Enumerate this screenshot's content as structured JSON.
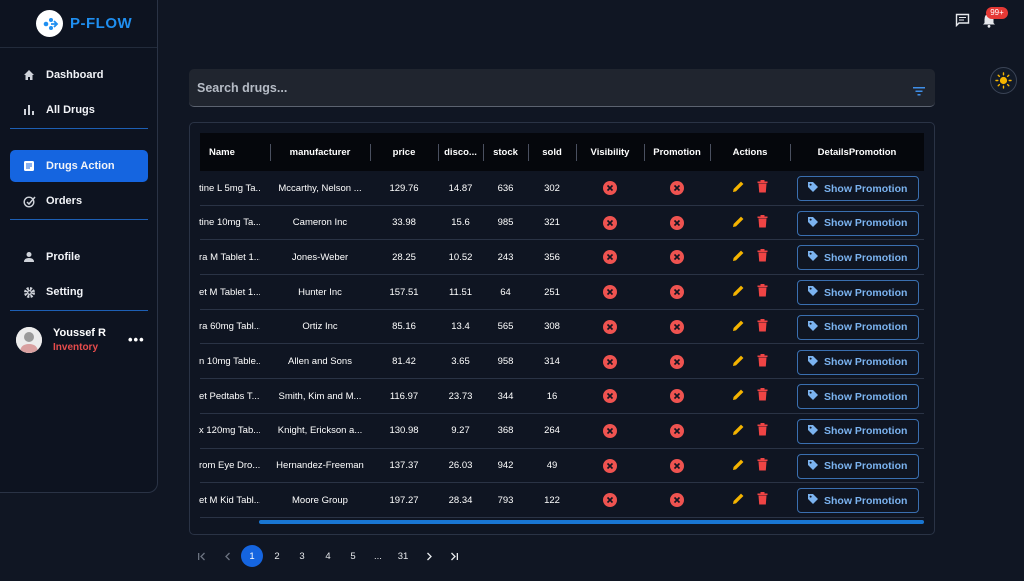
{
  "brand": {
    "name": "P-FLOW"
  },
  "nav": {
    "items": [
      {
        "label": "Dashboard",
        "icon": "home-icon"
      },
      {
        "label": "All Drugs",
        "icon": "bar-chart-icon"
      },
      {
        "label": "Drugs Action",
        "icon": "document-icon",
        "active": true
      },
      {
        "label": "Orders",
        "icon": "check-circle-icon"
      },
      {
        "label": "Profile",
        "icon": "person-icon"
      },
      {
        "label": "Setting",
        "icon": "gear-icon"
      }
    ]
  },
  "user": {
    "name": "Youssef R",
    "role": "Inventory",
    "more": "•••"
  },
  "header": {
    "notification_count": "99+"
  },
  "search": {
    "placeholder": "Search drugs...",
    "value": ""
  },
  "table": {
    "columns": [
      "Name",
      "manufacturer",
      "price",
      "disco...",
      "stock",
      "sold",
      "Visibility",
      "Promotion",
      "Actions",
      "DetailsPromotion"
    ],
    "promo_button_label": "Show Promotion",
    "rows": [
      {
        "name": "tine L 5mg Ta...",
        "manufacturer": "Mccarthy, Nelson ...",
        "price": "129.76",
        "discount": "14.87",
        "stock": "636",
        "sold": "302"
      },
      {
        "name": "tine 10mg Ta...",
        "manufacturer": "Cameron Inc",
        "price": "33.98",
        "discount": "15.6",
        "stock": "985",
        "sold": "321"
      },
      {
        "name": "ra M Tablet 1...",
        "manufacturer": "Jones-Weber",
        "price": "28.25",
        "discount": "10.52",
        "stock": "243",
        "sold": "356"
      },
      {
        "name": "et M Tablet 1...",
        "manufacturer": "Hunter Inc",
        "price": "157.51",
        "discount": "11.51",
        "stock": "64",
        "sold": "251"
      },
      {
        "name": "ra 60mg Tabl...",
        "manufacturer": "Ortiz Inc",
        "price": "85.16",
        "discount": "13.4",
        "stock": "565",
        "sold": "308"
      },
      {
        "name": "n 10mg Table...",
        "manufacturer": "Allen and Sons",
        "price": "81.42",
        "discount": "3.65",
        "stock": "958",
        "sold": "314"
      },
      {
        "name": "et Pedtabs T...",
        "manufacturer": "Smith, Kim and M...",
        "price": "116.97",
        "discount": "23.73",
        "stock": "344",
        "sold": "16"
      },
      {
        "name": "x 120mg Tab...",
        "manufacturer": "Knight, Erickson a...",
        "price": "130.98",
        "discount": "9.27",
        "stock": "368",
        "sold": "264"
      },
      {
        "name": "rom Eye Dro...",
        "manufacturer": "Hernandez-Freeman",
        "price": "137.37",
        "discount": "26.03",
        "stock": "942",
        "sold": "49"
      },
      {
        "name": "et M Kid Tabl...",
        "manufacturer": "Moore Group",
        "price": "197.27",
        "discount": "28.34",
        "stock": "793",
        "sold": "122"
      }
    ]
  },
  "pagination": {
    "pages": [
      "1",
      "2",
      "3",
      "4",
      "5",
      "...",
      "31"
    ],
    "current": "1"
  },
  "colors": {
    "accent": "#1565e0",
    "danger": "#ef5350",
    "edit": "#f5b400",
    "background": "#101623"
  }
}
